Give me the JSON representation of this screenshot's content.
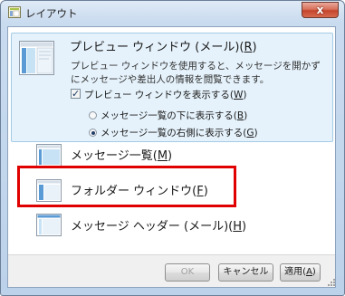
{
  "window": {
    "title": "レイアウト",
    "close_glyph": "x",
    "accent_color": "#e10000"
  },
  "preview": {
    "title_text": "プレビュー ウィンドウ (メール)(",
    "title_key": "R",
    "title_suffix": ")",
    "description": "プレビュー ウィンドウを使用すると、メッセージを開かずにメッセージや差出人の情報を閲覧できます。",
    "checkbox_text": "プレビュー ウィンドウを表示する(",
    "checkbox_key": "W",
    "checkbox_suffix": ")",
    "checked": true,
    "radio_below_text": "メッセージ一覧の下に表示する(",
    "radio_below_key": "B",
    "radio_below_suffix": ")",
    "radio_right_text": "メッセージ一覧の右側に表示する(",
    "radio_right_key": "G",
    "radio_right_suffix": ")",
    "selected_radio": "right"
  },
  "options": [
    {
      "text": "メッセージ一覧(",
      "key": "M",
      "suffix": ")"
    },
    {
      "text": "フォルダー ウィンドウ(",
      "key": "F",
      "suffix": ")"
    },
    {
      "text": "メッセージ ヘッダー (メール)(",
      "key": "H",
      "suffix": ")"
    }
  ],
  "buttons": {
    "ok": "OK",
    "cancel": "キャンセル",
    "apply_text": "適用(",
    "apply_key": "A",
    "apply_suffix": ")"
  }
}
